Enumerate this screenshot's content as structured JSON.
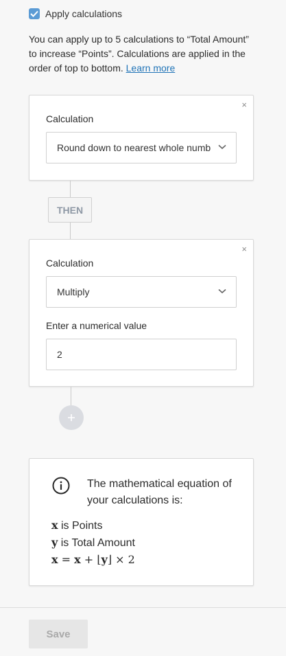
{
  "apply": {
    "label": "Apply calculations",
    "checked": true
  },
  "intro": {
    "text": "You can apply up to 5 calculations to “Total Amount” to increase “Points”. Calculations are applied in the order of top to bottom. ",
    "link": "Learn more"
  },
  "calculations": [
    {
      "label": "Calculation",
      "value": "Round down to nearest whole number",
      "close": "×"
    },
    {
      "label": "Calculation",
      "value": "Multiply",
      "close": "×",
      "numeric_label": "Enter a numerical value",
      "numeric_value": "2"
    }
  ],
  "then_label": "THEN",
  "info": {
    "heading": "The mathematical equation of your calculations is:",
    "x_var": "x",
    "x_desc": " is Points",
    "y_var": "y",
    "y_desc": " is Total Amount",
    "equation": {
      "lhs": "x",
      "eq": " = ",
      "x2": "x",
      "plus": " + ",
      "floor_open": "⌊",
      "y": "y",
      "floor_close": "⌋",
      "times": " × ",
      "factor": "2"
    }
  },
  "save_label": "Save",
  "colors": {
    "accent": "#5b9bd5",
    "link": "#1f73b7",
    "then_text": "#8e98a5"
  }
}
